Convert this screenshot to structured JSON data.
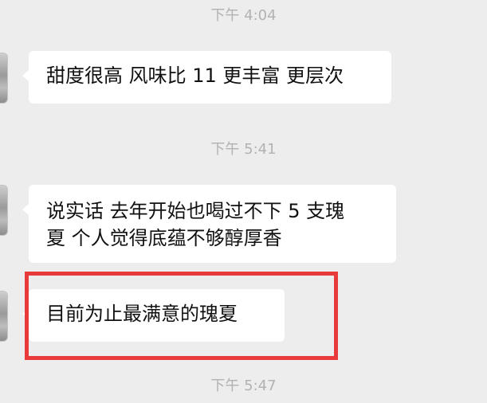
{
  "messages": [
    {
      "type": "time",
      "text": "下午 4:04"
    },
    {
      "type": "msg",
      "text": "甜度很高 风味比 11 更丰富 更层次"
    },
    {
      "type": "time",
      "text": "下午 5:41"
    },
    {
      "type": "msg",
      "lines": [
        "说实话 去年开始也喝过不下 5 支瑰",
        "夏 个人觉得底蕴不够醇厚香"
      ]
    },
    {
      "type": "msg",
      "text": "目前为止最满意的瑰夏"
    },
    {
      "type": "time",
      "text": "下午 5:47"
    }
  ],
  "colors": {
    "background": "#ededed",
    "bubble": "#ffffff",
    "timestamp": "#b2b2b2",
    "highlight": "#e83a3a"
  }
}
